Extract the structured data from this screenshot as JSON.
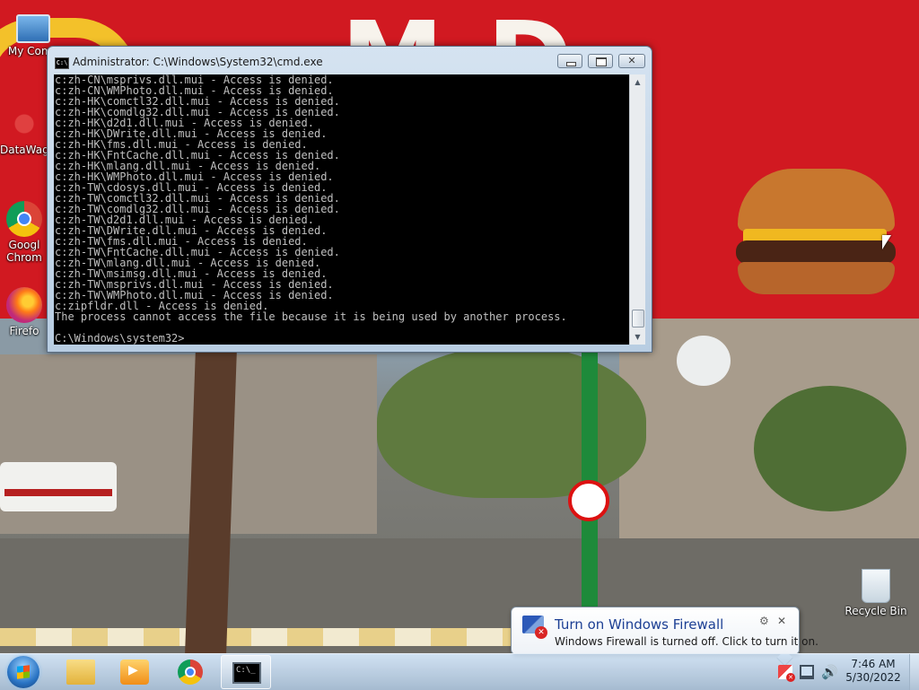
{
  "desktop": {
    "icons": [
      {
        "label": "My Comp",
        "icon": "computer-icon"
      },
      {
        "label": "DataWag",
        "icon": "datawag-icon"
      },
      {
        "label": "Googl",
        "label2": "Chrom",
        "icon": "chrome-icon"
      },
      {
        "label": "Firefo",
        "icon": "firefox-icon"
      },
      {
        "label": "Recycle Bin",
        "icon": "recycle-bin-icon"
      }
    ]
  },
  "cmd": {
    "title": "Administrator: C:\\Windows\\System32\\cmd.exe",
    "lines": [
      "c:zh-CN\\msprivs.dll.mui - Access is denied.",
      "c:zh-CN\\WMPhoto.dll.mui - Access is denied.",
      "c:zh-HK\\comctl32.dll.mui - Access is denied.",
      "c:zh-HK\\comdlg32.dll.mui - Access is denied.",
      "c:zh-HK\\d2d1.dll.mui - Access is denied.",
      "c:zh-HK\\DWrite.dll.mui - Access is denied.",
      "c:zh-HK\\fms.dll.mui - Access is denied.",
      "c:zh-HK\\FntCache.dll.mui - Access is denied.",
      "c:zh-HK\\mlang.dll.mui - Access is denied.",
      "c:zh-HK\\WMPhoto.dll.mui - Access is denied.",
      "c:zh-TW\\cdosys.dll.mui - Access is denied.",
      "c:zh-TW\\comctl32.dll.mui - Access is denied.",
      "c:zh-TW\\comdlg32.dll.mui - Access is denied.",
      "c:zh-TW\\d2d1.dll.mui - Access is denied.",
      "c:zh-TW\\DWrite.dll.mui - Access is denied.",
      "c:zh-TW\\fms.dll.mui - Access is denied.",
      "c:zh-TW\\FntCache.dll.mui - Access is denied.",
      "c:zh-TW\\mlang.dll.mui - Access is denied.",
      "c:zh-TW\\msimsg.dll.mui - Access is denied.",
      "c:zh-TW\\msprivs.dll.mui - Access is denied.",
      "c:zh-TW\\WMPhoto.dll.mui - Access is denied.",
      "c:zipfldr.dll - Access is denied.",
      "The process cannot access the file because it is being used by another process.",
      "",
      "C:\\Windows\\system32>"
    ],
    "buttons": {
      "minimize": "minimize",
      "maximize": "maximize",
      "close": "✕"
    }
  },
  "taskbar": {
    "items": [
      {
        "name": "windows-explorer",
        "icon": "folder-icon",
        "active": false
      },
      {
        "name": "media-player",
        "icon": "media-player-icon",
        "active": false
      },
      {
        "name": "google-chrome",
        "icon": "chrome-icon",
        "active": false
      },
      {
        "name": "command-prompt",
        "icon": "cmd-icon",
        "active": true
      }
    ],
    "clock": {
      "time": "7:46 AM",
      "date": "5/30/2022"
    }
  },
  "firewall_notification": {
    "title": "Turn on Windows Firewall",
    "body": "Windows Firewall is turned off. Click to turn it on.",
    "icon": "firewall-flag-icon"
  },
  "colors": {
    "console_bg": "#000000",
    "console_text": "#c0c0c0",
    "notification_title": "#1c3f94"
  }
}
